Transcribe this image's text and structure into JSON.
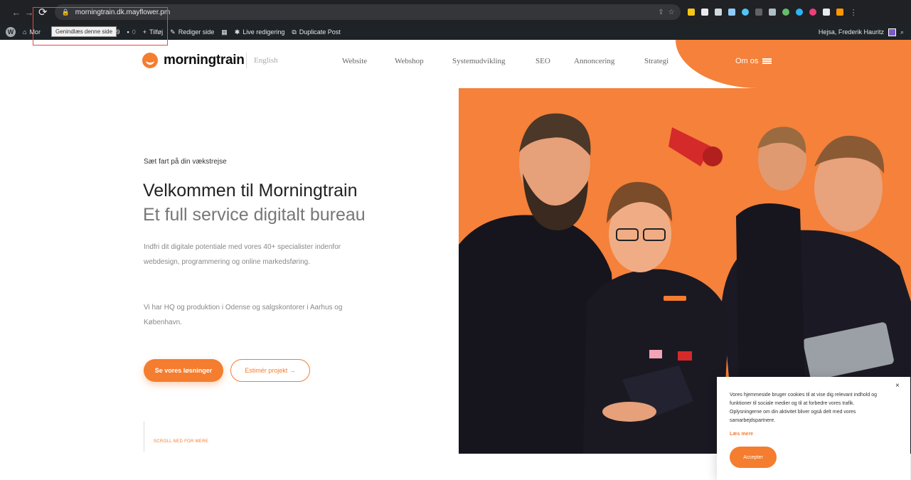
{
  "browser": {
    "url": "morningtrain.dk.mayflower.pm"
  },
  "wp_admin": {
    "site_abbrev": "Mor",
    "tooltip": "Genindlæs denne side",
    "updates": "29",
    "comments": "0",
    "add_new": "Tilføj",
    "edit_page": "Rediger side",
    "live_edit": "Live redigering",
    "duplicate": "Duplicate Post",
    "greeting": "Hejsa, Frederik Hauritz"
  },
  "header": {
    "logo": "morningtrain",
    "language": "English",
    "nav": [
      "Website",
      "Webshop",
      "Systemudvikling",
      "SEO",
      "Annoncering",
      "Strategi"
    ],
    "about": "Om os"
  },
  "hero": {
    "eyebrow": "Sæt fart på din vækstrejse",
    "title": "Velkommen til Morningtrain",
    "subtitle": "Et full service digitalt bureau",
    "paragraph1": "Indfri dit digitale potentiale med vores 40+ specialister indenfor webdesign, programmering og online markedsføring.",
    "paragraph2": "Vi har HQ og produktion i Odense og salgskontorer i Aarhus og København.",
    "cta_primary": "Se vores løsninger",
    "cta_secondary": "Estimér projekt →",
    "scroll_hint": "SCROLL NED FOR MERE"
  },
  "cookie": {
    "text": "Vores hjemmeside bruger cookies til at vise dig relevant indhold og funktioner til sociale medier og til at forbedre vores trafik. Oplysningerne om din aktivitet bliver også delt med vores samarbejdspartnere.",
    "read_more": "Læs mere",
    "accept": "Accepter",
    "close": "×"
  },
  "colors": {
    "brand_orange": "#f47d2f",
    "browser_dark": "#202124",
    "wp_bar": "#1d2327"
  }
}
